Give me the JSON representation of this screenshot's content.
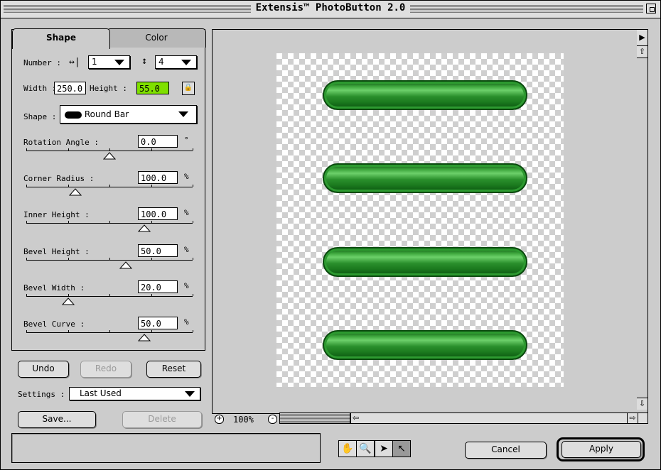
{
  "window": {
    "title": "Extensis™ PhotoButton 2.0"
  },
  "tabs": [
    {
      "label": "Shape",
      "active": true
    },
    {
      "label": "Color",
      "active": false
    }
  ],
  "number": {
    "label": "Number :",
    "horizontal": "1",
    "vertical": "4"
  },
  "size": {
    "width_label": "Width :",
    "width": "250.0",
    "height_label": "Height :",
    "height": "55.0",
    "height_highlight": "#7fe000"
  },
  "shape": {
    "label": "Shape :",
    "value": "Round Bar"
  },
  "params": [
    {
      "label": "Rotation Angle :",
      "value": "0.0",
      "unit": "°",
      "level": 0.5
    },
    {
      "label": "Corner Radius :",
      "value": "100.0",
      "unit": "%",
      "level": 0.25
    },
    {
      "label": "Inner Height :",
      "value": "100.0",
      "unit": "%",
      "level": 0.75
    },
    {
      "label": "Bevel Height :",
      "value": "50.0",
      "unit": "%",
      "level": 0.62
    },
    {
      "label": "Bevel Width :",
      "value": "20.0",
      "unit": "%",
      "level": 0.2
    },
    {
      "label": "Bevel Curve :",
      "value": "50.0",
      "unit": "%",
      "level": 0.75
    }
  ],
  "buttons": {
    "undo": "Undo",
    "redo": "Redo",
    "reset": "Reset",
    "save": "Save...",
    "delete": "Delete",
    "cancel": "Cancel",
    "apply": "Apply"
  },
  "settings": {
    "label": "Settings :",
    "value": "Last Used"
  },
  "zoom": {
    "level": "100%"
  },
  "tools": [
    "hand-icon",
    "magnifier-icon",
    "move-icon",
    "arrow-pointer-icon"
  ],
  "colors": {
    "button_green": "#2a8f2c"
  }
}
